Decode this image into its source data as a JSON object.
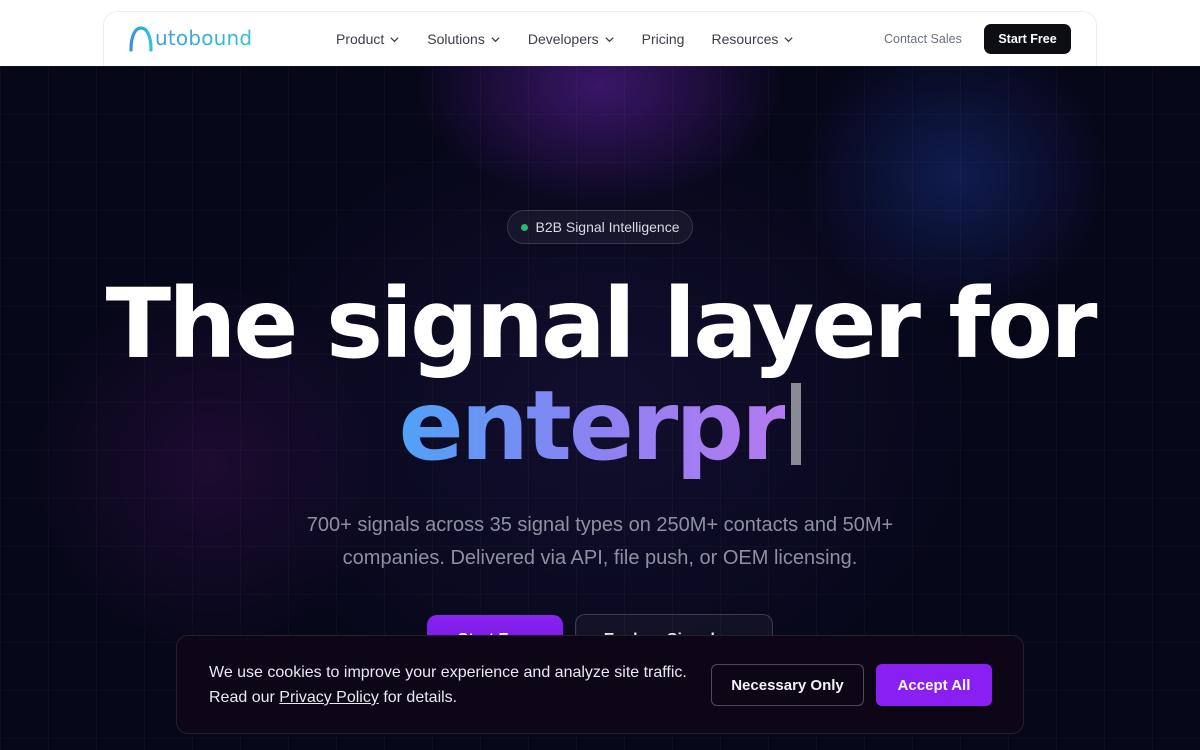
{
  "brand": {
    "name": "utobound",
    "logo_icon": "autobound-a-arch-icon"
  },
  "nav": {
    "items": [
      {
        "label": "Product",
        "has_dropdown": true
      },
      {
        "label": "Solutions",
        "has_dropdown": true
      },
      {
        "label": "Developers",
        "has_dropdown": true
      },
      {
        "label": "Pricing",
        "has_dropdown": false
      },
      {
        "label": "Resources",
        "has_dropdown": true
      }
    ],
    "contact_label": "Contact Sales",
    "cta_label": "Start Free"
  },
  "hero": {
    "badge": "B2B Signal Intelligence",
    "headline_line1": "The signal layer for",
    "headline_typed": "enterpr",
    "subheadline": "700+ signals across 35 signal types on 250M+ contacts and 50M+ companies. Delivered via API, file push, or OEM licensing.",
    "cta_primary": "Start Free",
    "cta_secondary": "Explore Signals →"
  },
  "cookie_banner": {
    "text_line1": "We use cookies to improve your experience and analyze site traffic.",
    "text_prefix": "Read our",
    "link_label": "Privacy Policy",
    "text_suffix": "for details.",
    "necessary_label": "Necessary Only",
    "accept_label": "Accept All"
  },
  "colors": {
    "accent_purple": "#8a1ff2",
    "badge_dot": "#2bb673",
    "hero_bg": "#07071a"
  }
}
